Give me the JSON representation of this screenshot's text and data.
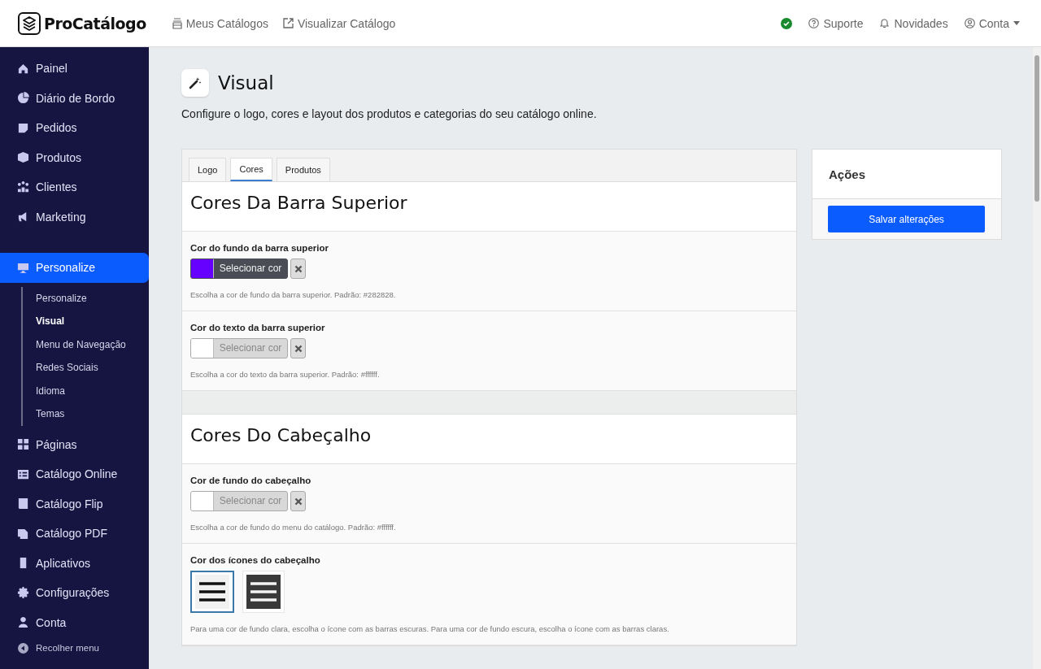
{
  "header": {
    "logo": "ProCatálogo",
    "nav": [
      {
        "label": "Meus Catálogos"
      },
      {
        "label": "Visualizar Catálogo"
      }
    ],
    "links": [
      {
        "label": "Suporte"
      },
      {
        "label": "Novidades"
      },
      {
        "label": "Conta",
        "dropdown": true
      }
    ]
  },
  "sidebar": {
    "items": [
      {
        "label": "Painel",
        "selected": false
      },
      {
        "label": "Diário de Bordo",
        "selected": false
      },
      {
        "label": "Pedidos",
        "selected": false
      },
      {
        "label": "Produtos",
        "selected": false
      },
      {
        "label": "Clientes",
        "selected": false
      },
      {
        "label": "Marketing",
        "selected": false
      },
      {
        "label": "Personalize",
        "selected": true,
        "expanded": true,
        "children": [
          {
            "label": "Personalize",
            "selected": false
          },
          {
            "label": "Visual",
            "selected": true
          },
          {
            "label": "Menu de Navegação",
            "selected": false
          },
          {
            "label": "Redes Sociais",
            "selected": false
          },
          {
            "label": "Idioma",
            "selected": false
          },
          {
            "label": "Temas",
            "selected": false
          }
        ]
      },
      {
        "label": "Páginas",
        "selected": false
      },
      {
        "label": "Catálogo Online",
        "selected": false
      },
      {
        "label": "Catálogo Flip",
        "selected": false
      },
      {
        "label": "Catálogo PDF",
        "selected": false
      },
      {
        "label": "Aplicativos",
        "selected": false
      },
      {
        "label": "Configurações",
        "selected": false
      },
      {
        "label": "Conta",
        "selected": false
      }
    ],
    "collapse": "Recolher menu"
  },
  "page": {
    "title": "Visual",
    "description": "Configure o logo, cores e layout dos produtos e categorias do seu catálogo online."
  },
  "tabs": [
    {
      "label": "Logo",
      "selected": false
    },
    {
      "label": "Cores",
      "selected": true
    },
    {
      "label": "Produtos",
      "selected": false
    }
  ],
  "sections": [
    {
      "title": "Cores Da Barra Superior",
      "fields": [
        {
          "kind": "color",
          "label": "Cor do fundo da barra superior",
          "button": "Selecionar cor",
          "has_value": true,
          "color": "#6600ff",
          "help": "Escolha a cor de fundo da barra superior. Padrão: #282828."
        },
        {
          "kind": "color",
          "label": "Cor do texto da barra superior",
          "button": "Selecionar cor",
          "has_value": false,
          "color": "#ffffff",
          "help": "Escolha a cor do texto da barra superior. Padrão: #ffffff."
        }
      ]
    },
    {
      "title": "Cores Do Cabeçalho",
      "fields": [
        {
          "kind": "color",
          "label": "Cor de fundo do cabeçalho",
          "button": "Selecionar cor",
          "has_value": false,
          "color": "#ffffff",
          "help": "Escolha a cor de fundo do menu do catálogo. Padrão: #ffffff."
        },
        {
          "kind": "icons",
          "label": "Cor dos ícones do cabeçalho",
          "options": [
            {
              "kind": "dark-bars",
              "selected": true
            },
            {
              "kind": "light-bars",
              "selected": false
            }
          ],
          "help": "Para uma cor de fundo clara, escolha o ícone com as barras escuras. Para uma cor de fundo escura, escolha o ícone com as barras claras."
        }
      ]
    }
  ],
  "actions": {
    "title": "Ações",
    "button": "Salvar alterações"
  }
}
